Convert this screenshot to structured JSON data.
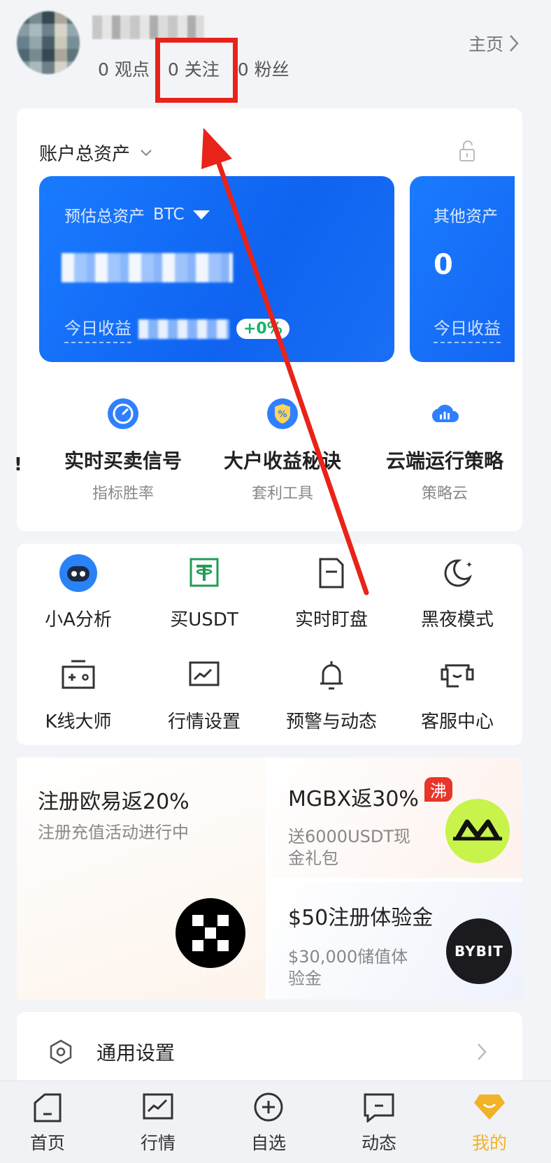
{
  "profile": {
    "stats": [
      {
        "count": "0",
        "label": "观点"
      },
      {
        "count": "0",
        "label": "关注"
      },
      {
        "count": "0",
        "label": "粉丝"
      }
    ],
    "homepage_label": "主页"
  },
  "assets": {
    "title": "账户总资产",
    "main_card": {
      "label": "预估总资产",
      "currency": "BTC",
      "today_label": "今日收益",
      "today_pct": "+0%"
    },
    "side_card": {
      "label": "其他资产",
      "value": "0",
      "today_label": "今日收益"
    }
  },
  "features": [
    {
      "title": "实时买卖信号",
      "sub": "指标胜率",
      "icon": "speedometer-icon"
    },
    {
      "title": "大户收益秘诀",
      "sub": "套利工具",
      "icon": "shield-percent-icon"
    },
    {
      "title": "云端运行策略",
      "sub": "策略云",
      "icon": "cloud-chart-icon"
    }
  ],
  "tools": [
    {
      "label": "小A分析",
      "icon": "robot-icon"
    },
    {
      "label": "买USDT",
      "icon": "usdt-icon"
    },
    {
      "label": "实时盯盘",
      "icon": "monitor-tag-icon"
    },
    {
      "label": "黑夜模式",
      "icon": "moon-icon"
    },
    {
      "label": "K线大师",
      "icon": "kline-box-icon"
    },
    {
      "label": "行情设置",
      "icon": "chart-settings-icon"
    },
    {
      "label": "预警与动态",
      "icon": "bell-icon"
    },
    {
      "label": "客服中心",
      "icon": "headset-icon"
    }
  ],
  "promos": {
    "okx": {
      "title": "注册欧易返20%",
      "sub": "注册充值活动进行中"
    },
    "mgbx": {
      "title": "MGBX返30%",
      "badge": "沸",
      "sub_line1": "送6000USDT现",
      "sub_line2": "金礼包"
    },
    "bybit": {
      "title": "$50注册体验金",
      "sub_line1": "$30,000储值体",
      "sub_line2": "验金",
      "logo_text": "BYBIT"
    }
  },
  "settings": {
    "label": "通用设置"
  },
  "nav": [
    {
      "label": "首页",
      "icon": "home-icon",
      "active": false
    },
    {
      "label": "行情",
      "icon": "market-chart-icon",
      "active": false
    },
    {
      "label": "自选",
      "icon": "add-circle-icon",
      "active": false
    },
    {
      "label": "动态",
      "icon": "message-icon",
      "active": false
    },
    {
      "label": "我的",
      "icon": "profile-gem-icon",
      "active": true
    }
  ],
  "colors": {
    "accent_blue": "#1a7bff",
    "highlight_red": "#e8231a",
    "nav_active": "#f2b227",
    "positive_green": "#13b466"
  }
}
